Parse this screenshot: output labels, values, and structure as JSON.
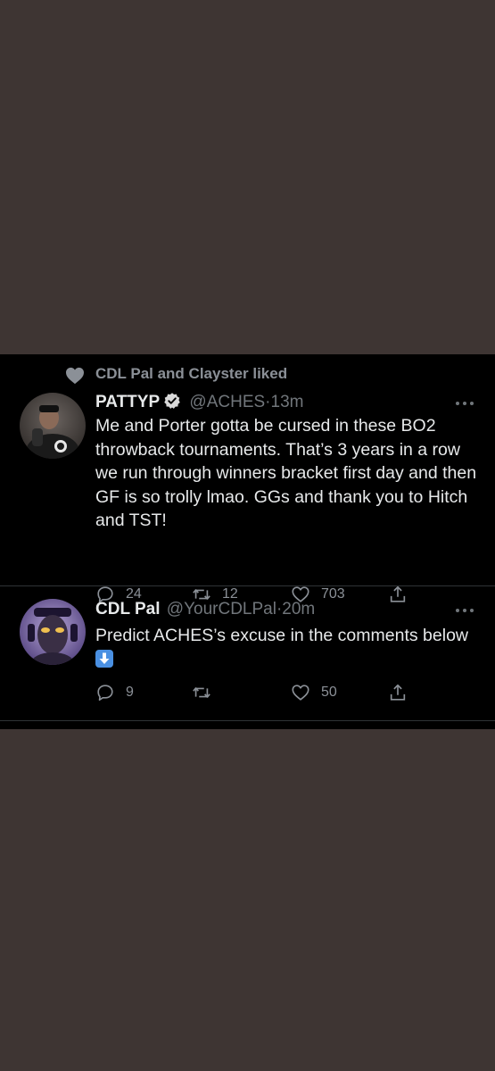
{
  "colors": {
    "outer_background": "#3e3533",
    "panel_background": "#000000",
    "primary_text": "#e7e9ea",
    "secondary_text": "#71767b",
    "verified_badge": "#d9d9d9"
  },
  "social_context": {
    "icon": "heart-icon",
    "text": "CDL Pal and Clayster liked"
  },
  "tweets": [
    {
      "display_name": "PATTYP",
      "verified": true,
      "handle": "@ACHES",
      "separator": "·",
      "time": "13m",
      "text": "Me and Porter gotta be cursed in these BO2 throwback tournaments. That’s 3 years in a row we run through winners bracket first day and then GF is so trolly lmao. GGs and thank you to Hitch and TST!",
      "replies": "24",
      "retweets": "12",
      "likes": "703"
    },
    {
      "display_name": "CDL Pal",
      "verified": false,
      "handle": "@YourCDLPal",
      "separator": "·",
      "time": "20m",
      "text": "Predict ACHES’s excuse in the comments below",
      "emoji": "down-arrow-emoji",
      "replies": "9",
      "retweets": "",
      "likes": "50"
    }
  ]
}
